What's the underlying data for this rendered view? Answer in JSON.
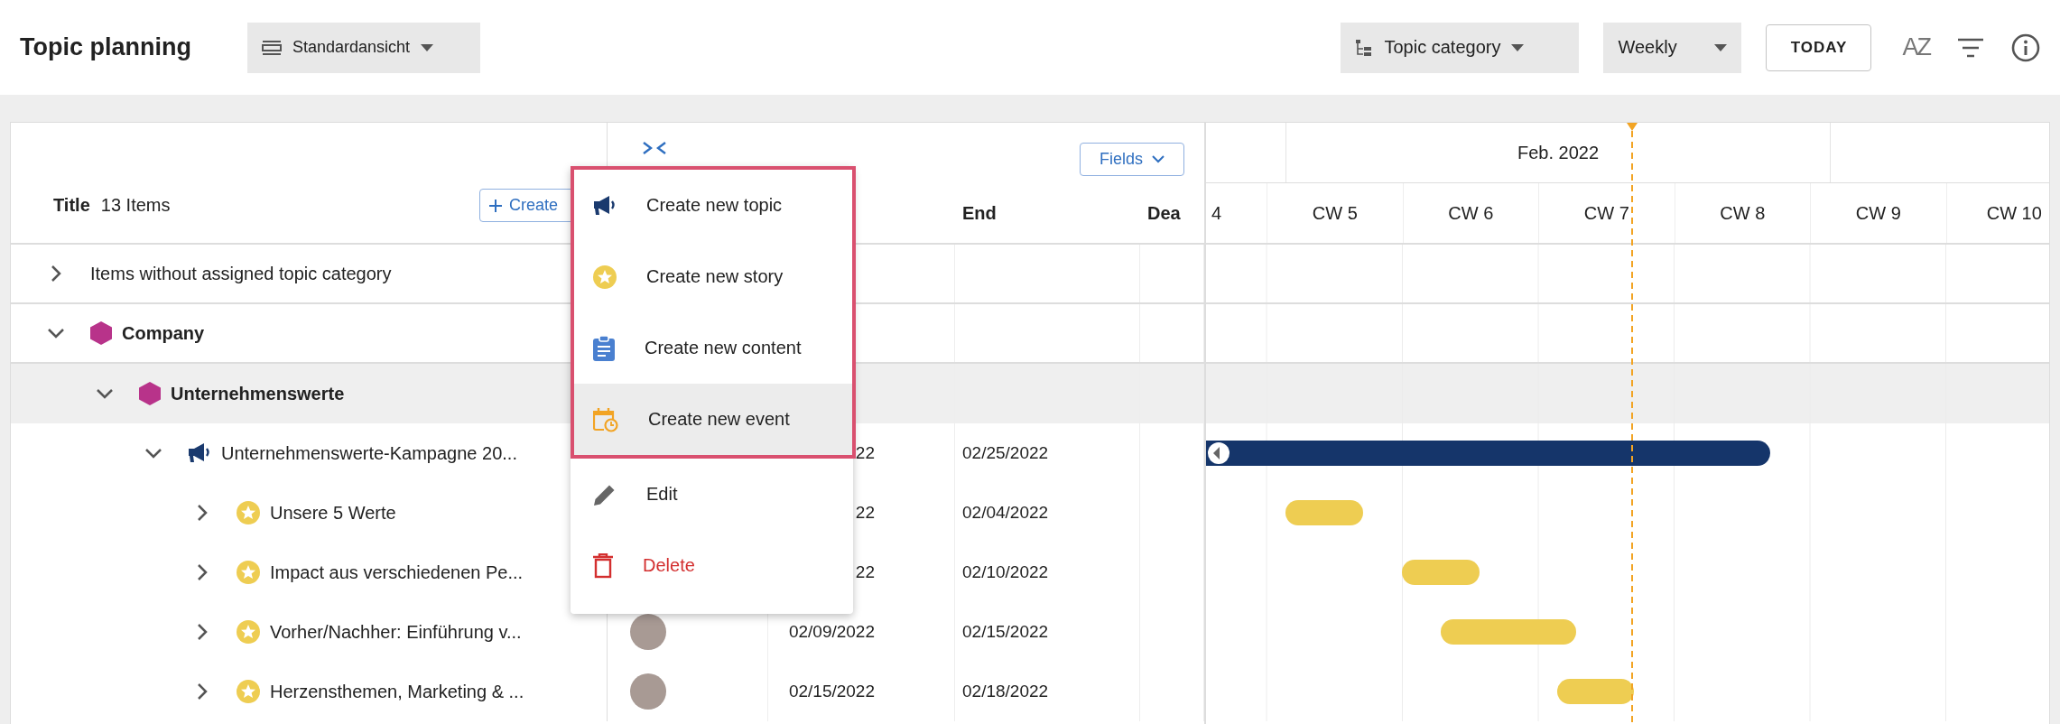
{
  "header": {
    "title": "Topic planning",
    "view_dropdown": "Standardansicht",
    "grouping_dropdown": "Topic category",
    "scale_dropdown": "Weekly",
    "today_button": "TODAY",
    "sort_button": "AZ"
  },
  "table": {
    "title_column": "Title",
    "item_count": "13 Items",
    "create_button": "Create",
    "fields_button": "Fields",
    "end_column": "End",
    "column_5": "Dea"
  },
  "timeline": {
    "month": "Feb. 2022",
    "weeks": [
      "4",
      "CW 5",
      "CW 6",
      "CW 7",
      "CW 8",
      "CW 9",
      "CW 10"
    ]
  },
  "rows": [
    {
      "kind": "group",
      "title": "Items without assigned topic category",
      "expanded": false,
      "selected": false
    },
    {
      "kind": "category",
      "title": "Company",
      "color": "#b8338a",
      "expanded": true,
      "selected": false,
      "children": [
        {
          "kind": "category",
          "title": "Unternehmenswerte",
          "color": "#b8338a",
          "expanded": true,
          "selected": true,
          "children": [
            {
              "kind": "topic",
              "title": "Unternehmenswerte-Kampagne 20...",
              "expanded": true,
              "selected": false,
              "avatar": false,
              "start": "22",
              "end": "02/25/2022",
              "children": [
                {
                  "kind": "story",
                  "title": "Unsere 5 Werte",
                  "expanded": false,
                  "selected": false,
                  "avatar": false,
                  "start": "22",
                  "end": "02/04/2022"
                },
                {
                  "kind": "story",
                  "title": "Impact aus verschiedenen Pe...",
                  "expanded": false,
                  "selected": false,
                  "avatar": false,
                  "start": "22",
                  "end": "02/10/2022"
                },
                {
                  "kind": "story",
                  "title": "Vorher/Nachher: Einführung v...",
                  "expanded": false,
                  "selected": false,
                  "avatar": true,
                  "start": "02/09/2022",
                  "end": "02/15/2022"
                },
                {
                  "kind": "story",
                  "title": "Herzensthemen, Marketing & ...",
                  "expanded": false,
                  "selected": false,
                  "avatar": true,
                  "start": "02/15/2022",
                  "end": "02/18/2022"
                }
              ]
            }
          ]
        }
      ]
    }
  ],
  "context_menu": {
    "create_options": [
      {
        "kind": "topic",
        "label": "Create new topic",
        "selected": false
      },
      {
        "kind": "story",
        "label": "Create new story",
        "selected": false
      },
      {
        "kind": "content",
        "label": "Create new content",
        "selected": false
      },
      {
        "kind": "event",
        "label": "Create new event",
        "selected": true
      }
    ],
    "actions": [
      {
        "kind": "edit",
        "label": "Edit",
        "selected": false
      },
      {
        "kind": "delete",
        "label": "Delete",
        "selected": false
      }
    ]
  }
}
